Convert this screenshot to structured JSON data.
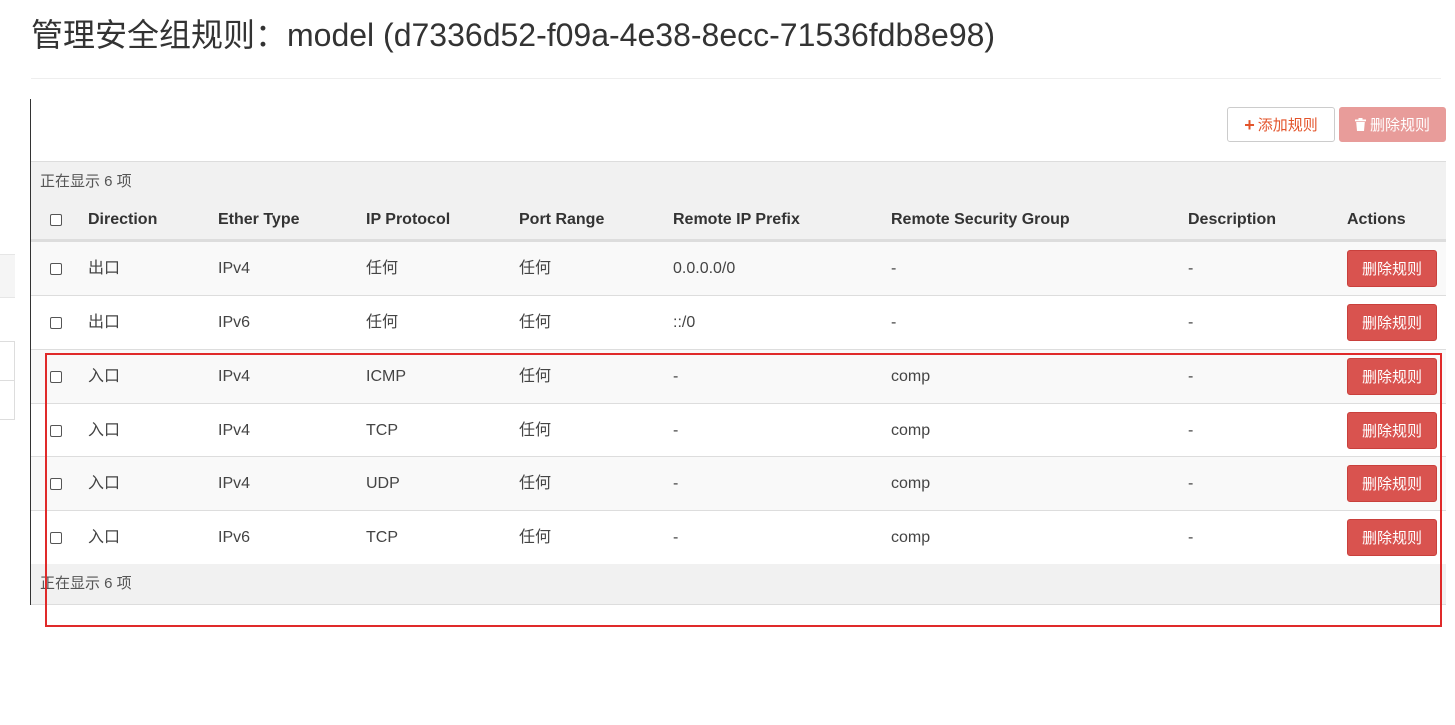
{
  "page": {
    "title": "管理安全组规则：model (d7336d52-f09a-4e38-8ecc-71536fdb8e98)"
  },
  "toolbar": {
    "add_rule_label": "添加规则",
    "add_rule_icon": "plus-icon",
    "delete_rules_label": "删除规则",
    "delete_rules_icon": "trash-icon"
  },
  "table": {
    "count_text": "正在显示 6 项",
    "headers": {
      "direction": "Direction",
      "ether_type": "Ether Type",
      "ip_protocol": "IP Protocol",
      "port_range": "Port Range",
      "remote_ip_prefix": "Remote IP Prefix",
      "remote_security_group": "Remote Security Group",
      "description": "Description",
      "actions": "Actions"
    },
    "rows": [
      {
        "direction": "出口",
        "ether_type": "IPv4",
        "ip_protocol": "任何",
        "port_range": "任何",
        "remote_ip_prefix": "0.0.0.0/0",
        "remote_security_group": "-",
        "description": "-",
        "action_label": "删除规则"
      },
      {
        "direction": "出口",
        "ether_type": "IPv6",
        "ip_protocol": "任何",
        "port_range": "任何",
        "remote_ip_prefix": "::/0",
        "remote_security_group": "-",
        "description": "-",
        "action_label": "删除规则"
      },
      {
        "direction": "入口",
        "ether_type": "IPv4",
        "ip_protocol": "ICMP",
        "port_range": "任何",
        "remote_ip_prefix": "-",
        "remote_security_group": "comp",
        "description": "-",
        "action_label": "删除规则"
      },
      {
        "direction": "入口",
        "ether_type": "IPv4",
        "ip_protocol": "TCP",
        "port_range": "任何",
        "remote_ip_prefix": "-",
        "remote_security_group": "comp",
        "description": "-",
        "action_label": "删除规则"
      },
      {
        "direction": "入口",
        "ether_type": "IPv4",
        "ip_protocol": "UDP",
        "port_range": "任何",
        "remote_ip_prefix": "-",
        "remote_security_group": "comp",
        "description": "-",
        "action_label": "删除规则"
      },
      {
        "direction": "入口",
        "ether_type": "IPv6",
        "ip_protocol": "TCP",
        "port_range": "任何",
        "remote_ip_prefix": "-",
        "remote_security_group": "comp",
        "description": "-",
        "action_label": "删除规则"
      }
    ]
  },
  "colors": {
    "danger": "#d9534f",
    "danger_disabled": "#e89c9a",
    "add_accent": "#e3542b",
    "highlight_annotation": "#e02a2a"
  }
}
